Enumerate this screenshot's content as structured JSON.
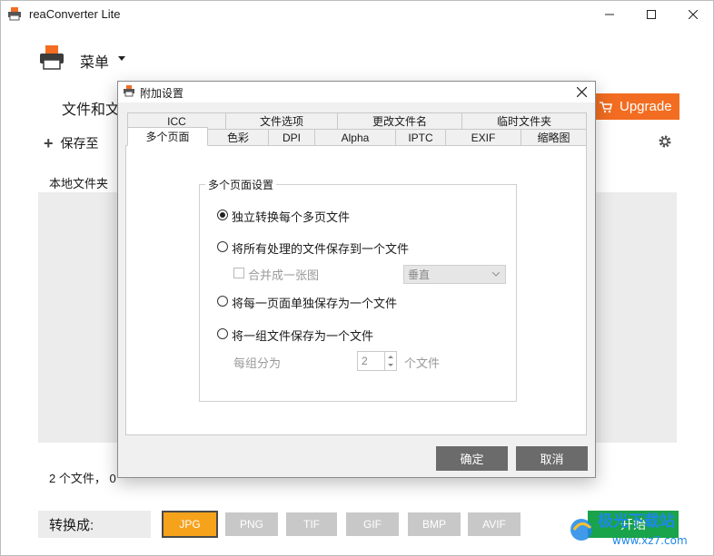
{
  "window": {
    "title": "reaConverter Lite"
  },
  "menu": {
    "label": "菜单"
  },
  "main": {
    "files_label": "文件和文",
    "upgrade_label": "Upgrade",
    "save_to_label": "保存至",
    "local_folder_label": "本地文件夹",
    "status_text": "2 个文件， 0",
    "convert_to_label": "转换成:",
    "formats": [
      "JPG",
      "PNG",
      "TIF",
      "GIF",
      "BMP",
      "AVIF"
    ],
    "active_format": "JPG",
    "start_label": "开始"
  },
  "dialog": {
    "title": "附加设置",
    "tabs_row1": [
      "ICC",
      "文件选项",
      "更改文件名",
      "临时文件夹"
    ],
    "tabs_row2": [
      "多个页面",
      "色彩",
      "DPI",
      "Alpha",
      "IPTC",
      "EXIF",
      "缩略图"
    ],
    "selected_tab": "多个页面",
    "group_title": "多个页面设置",
    "options": [
      {
        "label": "独立转换每个多页文件",
        "checked": true
      },
      {
        "label": "将所有处理的文件保存到一个文件",
        "checked": false
      },
      {
        "label": "将每一页面单独保存为一个文件",
        "checked": false
      },
      {
        "label": "将一组文件保存为一个文件",
        "checked": false
      }
    ],
    "merge_checkbox_label": "合并成一张图",
    "merge_direction": "垂直",
    "group_by_label": "每组分为",
    "group_by_value": "2",
    "group_by_unit": "个文件",
    "ok_label": "确定",
    "cancel_label": "取消"
  },
  "colors": {
    "accent_orange": "#f26d21",
    "format_active": "#f7a21b",
    "format_inactive": "#c8c8c8",
    "start_green": "#19a34a",
    "dialog_button": "#6b6b6b"
  },
  "watermark": {
    "text": "极光下载站",
    "url": "www.xz7.com"
  }
}
